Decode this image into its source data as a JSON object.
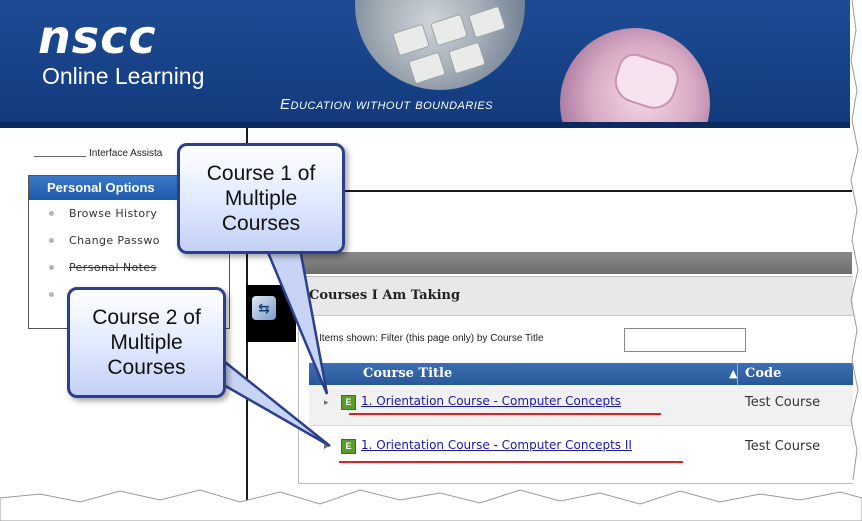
{
  "header": {
    "logo": "nscc",
    "logo_subtitle": "Online Learning",
    "tagline": "Education without boundaries"
  },
  "sidebar": {
    "assist_label": "Interface Assista",
    "panel_title": "Personal Options",
    "items": [
      {
        "label": "Browse History"
      },
      {
        "label": "Change Passwo"
      },
      {
        "label": "Personal Notes"
      },
      {
        "label": ""
      }
    ]
  },
  "courses": {
    "heading": "Courses I Am Taking",
    "count": "2",
    "filter_label": "Items shown: Filter (this page only) by Course Title",
    "filter_value": "",
    "columns": {
      "title": "Course Title",
      "sort_icon": "▲",
      "code": "Code"
    },
    "rows": [
      {
        "badge": "E",
        "title": "1. Orientation Course - Computer Concepts",
        "code": "Test Course"
      },
      {
        "badge": "E",
        "title": "1. Orientation Course - Computer Concepts II",
        "code": "Test Course"
      }
    ]
  },
  "callouts": {
    "one": {
      "line1": "Course 1 of",
      "line2": "Multiple",
      "line3": "Courses"
    },
    "two": {
      "line1": "Course 2 of",
      "line2": "Multiple",
      "line3": "Courses"
    }
  },
  "colors": {
    "banner_blue": "#1d4b93",
    "header_blue": "#285898",
    "link_blue": "#1a1aa6",
    "highlight_red": "#e02020",
    "callout_border": "#2b3f8a",
    "course_badge_green": "#5a9c2c"
  },
  "icons": {
    "nav": "navigation-arrows-icon",
    "course_badge": "course-e-badge-icon",
    "sort": "sort-ascending-icon",
    "row_marker": "row-pointer-icon"
  }
}
